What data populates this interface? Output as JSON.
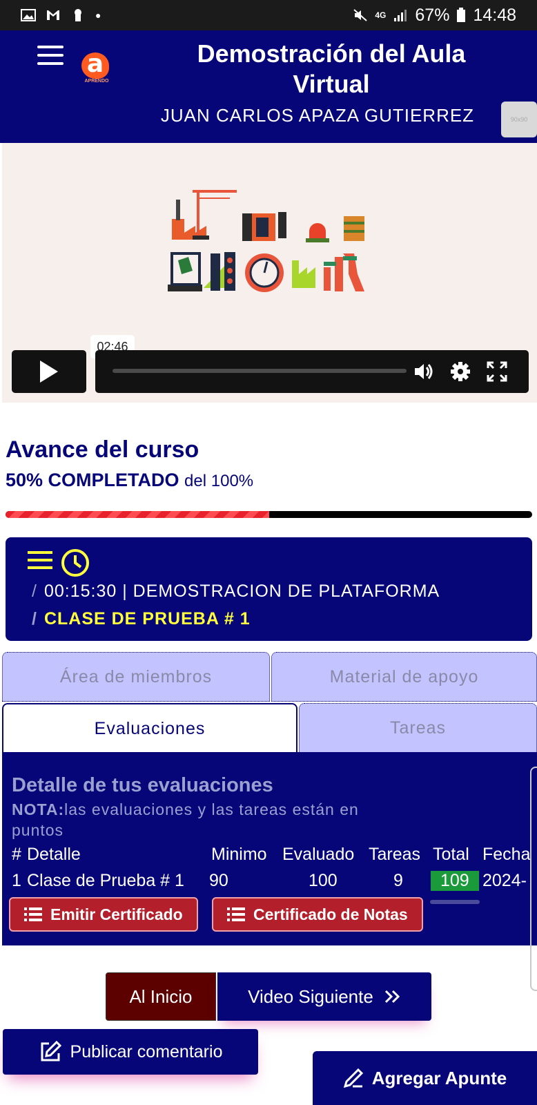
{
  "status_bar": {
    "battery": "67%",
    "time": "14:48",
    "network": "4G",
    "icons": [
      "image-icon",
      "gmail-icon",
      "keyhole-icon",
      "mute-icon",
      "signal-icon",
      "battery-icon"
    ]
  },
  "header": {
    "logo_text": "APRENDO",
    "title": "Demostración del Aula Virtual",
    "student_name": "JUAN CARLOS APAZA GUTIERREZ",
    "avatar_placeholder": "90x90"
  },
  "video": {
    "time_tooltip": "02:46"
  },
  "progress": {
    "title": "Avance del curso",
    "completed_label": "50% COMPLETADO",
    "of_total": "del 100%",
    "fraction": 0.5
  },
  "lesson": {
    "duration": "00:15:30",
    "module": "DEMOSTRACION DE PLATAFORMA",
    "class_name": "CLASE DE PRUEBA # 1"
  },
  "tabs": {
    "members": "Área de miembros",
    "material": "Material de apoyo",
    "evaluations": "Evaluaciones",
    "tasks": "Tareas"
  },
  "evaluations": {
    "heading": "Detalle de tus evaluaciones",
    "note_label": "NOTA:",
    "note_text": "las evaluaciones y las tareas están en puntos",
    "columns": [
      "#",
      "Detalle",
      "Minimo",
      "Evaluado",
      "Tareas",
      "Total",
      "Fecha"
    ],
    "rows": [
      {
        "num": "1",
        "detalle": "Clase de Prueba # 1",
        "minimo": "90",
        "evaluado": "100",
        "tareas": "9",
        "total": "109",
        "fecha": "2024-"
      }
    ],
    "emit_certificate": "Emitir Certificado",
    "grades_certificate": "Certificado de Notas"
  },
  "nav": {
    "home": "Al Inicio",
    "next_video": "Video Siguiente"
  },
  "actions": {
    "publish_comment": "Publicar comentario",
    "add_note": "Agregar Apunte"
  },
  "colors": {
    "primary": "#060679",
    "accent_yellow": "#ffff3b",
    "danger": "#b3202b",
    "success": "#1a9a3a",
    "tab_inactive": "#c3c3ff"
  }
}
